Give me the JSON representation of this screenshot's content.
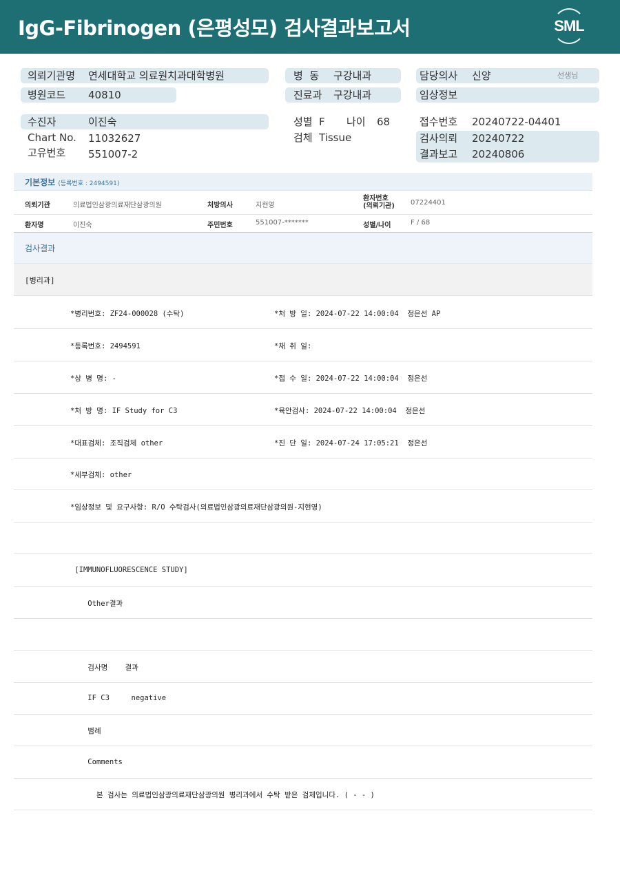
{
  "header": {
    "title": "IgG-Fibrinogen  (은평성모) 검사결과보고서",
    "logo_text": "SML"
  },
  "patient_info": {
    "request_org_label": "의뢰기관명",
    "request_org": "연세대학교 의료원치과대학병원",
    "hospital_code_label": "병원코드",
    "hospital_code": "40810",
    "ward_label": "병  동",
    "ward": "구강내과",
    "dept_label": "진료과",
    "dept": "구강내과",
    "doctor_label": "담당의사",
    "doctor": "신양",
    "doctor_suffix": "선생님",
    "clinical_label": "임상정보",
    "clinical": "",
    "patient_label": "수진자",
    "patient": "이진숙",
    "chart_label": "Chart No.",
    "chart": "11032627",
    "unique_label": "고유번호",
    "unique": "551007-2",
    "sex_label": "성별",
    "sex": "F",
    "age_label": "나이",
    "age": "68",
    "specimen_label": "검체",
    "specimen": "Tissue",
    "receipt_label": "접수번호",
    "receipt": "20240722-04401",
    "request_date_label": "검사의뢰",
    "request_date": "20240722",
    "report_date_label": "결과보고",
    "report_date": "20240806"
  },
  "basic_info": {
    "title": "기본정보",
    "reg_no": "(등록번호 : 2494591)",
    "row1": {
      "org_label": "의뢰기관",
      "org": "의료법인삼광의료재단삼광의원",
      "rx_doctor_label": "처방의사",
      "rx_doctor": "지현영",
      "pt_no_label_1": "환자번호",
      "pt_no_label_2": "(의뢰기관)",
      "pt_no": "07224401"
    },
    "row2": {
      "name_label": "환자명",
      "name": "이진숙",
      "ssn_label": "주민번호",
      "ssn": "551007-*******",
      "sexage_label": "성별/나이",
      "sexage": "F / 68"
    }
  },
  "exam": {
    "title": "검사결과",
    "section": "[병리과]"
  },
  "result_rows": [
    {
      "left": "*병리번호: ZF24-000028 (수탁)",
      "right": "*처 방 일: 2024-07-22 14:00:04  정은선 AP"
    },
    {
      "left": "*등록번호: 2494591",
      "right": "*채 취 일:"
    },
    {
      "left": "*상 병 명: -",
      "right": "*접 수 일: 2024-07-22 14:00:04  정은선"
    },
    {
      "left": "*처 방 명: IF Study for C3",
      "right": "*육안검사: 2024-07-22 14:00:04  정은선"
    },
    {
      "left": "*대표검체: 조직검체 other",
      "right": "*진 단 일: 2024-07-24 17:05:21  정은선"
    },
    {
      "left": "*세부검체: other",
      "right": ""
    },
    {
      "left": "*임상정보 및 요구사항: R/O 수탁검사(의료법인삼광의료재단삼광의원-지현영)",
      "right": ""
    },
    {
      "left": "",
      "right": ""
    },
    {
      "left": " [IMMUNOFLUORESCENCE STUDY]",
      "right": ""
    },
    {
      "left": "    Other결과",
      "right": ""
    },
    {
      "left": "",
      "right": ""
    },
    {
      "left": "    검사명    결과",
      "right": ""
    },
    {
      "left": "    IF C3     negative",
      "right": ""
    },
    {
      "left": "    범례",
      "right": ""
    },
    {
      "left": "    Comments",
      "right": ""
    },
    {
      "left": "      본 검사는 의료법인삼광의료재단삼광의원 병리과에서 수탁 받은 검체입니다. ( - - )",
      "right": ""
    }
  ]
}
